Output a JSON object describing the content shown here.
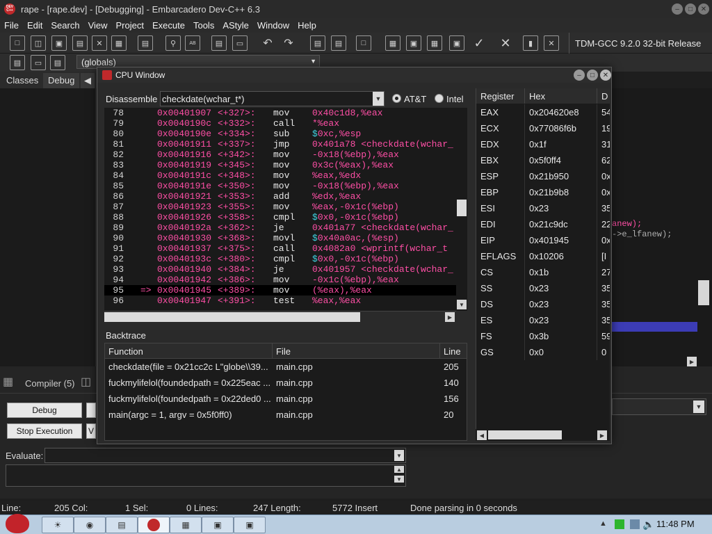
{
  "window": {
    "title": "rape - [rape.dev] - [Debugging] - Embarcadero Dev-C++ 6.3",
    "app_icon_text": "DEV C++"
  },
  "menu": [
    "File",
    "Edit",
    "Search",
    "View",
    "Project",
    "Execute",
    "Tools",
    "AStyle",
    "Window",
    "Help"
  ],
  "toolbar": {
    "compiler": "TDM-GCC 9.2.0 32-bit Release",
    "globals_combo": "(globals)"
  },
  "left_tabs": [
    "Classes",
    "Debug"
  ],
  "cpu_window": {
    "title": "CPU Window",
    "disassemble_label": "Disassemble",
    "function_combo": "checkdate(wchar_t*)",
    "syntax_options": [
      "AT&T",
      "Intel"
    ],
    "selected_syntax": "AT&T",
    "disassembly": [
      {
        "line": "78",
        "marker": "",
        "addr": "0x00401907",
        "offset": "<+327>:",
        "mnemonic": "mov",
        "operands": "0x40c1d8,%eax"
      },
      {
        "line": "79",
        "marker": "",
        "addr": "0x0040190c",
        "offset": "<+332>:",
        "mnemonic": "call",
        "operands": "*%eax"
      },
      {
        "line": "80",
        "marker": "",
        "addr": "0x0040190e",
        "offset": "<+334>:",
        "mnemonic": "sub",
        "operands": "$0xc,%esp"
      },
      {
        "line": "81",
        "marker": "",
        "addr": "0x00401911",
        "offset": "<+337>:",
        "mnemonic": "jmp",
        "operands": "0x401a78 <checkdate(wchar_"
      },
      {
        "line": "82",
        "marker": "",
        "addr": "0x00401916",
        "offset": "<+342>:",
        "mnemonic": "mov",
        "operands": "-0x18(%ebp),%eax"
      },
      {
        "line": "83",
        "marker": "",
        "addr": "0x00401919",
        "offset": "<+345>:",
        "mnemonic": "mov",
        "operands": "0x3c(%eax),%eax"
      },
      {
        "line": "84",
        "marker": "",
        "addr": "0x0040191c",
        "offset": "<+348>:",
        "mnemonic": "mov",
        "operands": "%eax,%edx"
      },
      {
        "line": "85",
        "marker": "",
        "addr": "0x0040191e",
        "offset": "<+350>:",
        "mnemonic": "mov",
        "operands": "-0x18(%ebp),%eax"
      },
      {
        "line": "86",
        "marker": "",
        "addr": "0x00401921",
        "offset": "<+353>:",
        "mnemonic": "add",
        "operands": "%edx,%eax"
      },
      {
        "line": "87",
        "marker": "",
        "addr": "0x00401923",
        "offset": "<+355>:",
        "mnemonic": "mov",
        "operands": "%eax,-0x1c(%ebp)"
      },
      {
        "line": "88",
        "marker": "",
        "addr": "0x00401926",
        "offset": "<+358>:",
        "mnemonic": "cmpl",
        "operands": "$0x0,-0x1c(%ebp)"
      },
      {
        "line": "89",
        "marker": "",
        "addr": "0x0040192a",
        "offset": "<+362>:",
        "mnemonic": "je",
        "operands": "0x401a77 <checkdate(wchar_"
      },
      {
        "line": "90",
        "marker": "",
        "addr": "0x00401930",
        "offset": "<+368>:",
        "mnemonic": "movl",
        "operands": "$0x40a0ac,(%esp)"
      },
      {
        "line": "91",
        "marker": "",
        "addr": "0x00401937",
        "offset": "<+375>:",
        "mnemonic": "call",
        "operands": "0x4082a0 <wprintf(wchar_t"
      },
      {
        "line": "92",
        "marker": "",
        "addr": "0x0040193c",
        "offset": "<+380>:",
        "mnemonic": "cmpl",
        "operands": "$0x0,-0x1c(%ebp)"
      },
      {
        "line": "93",
        "marker": "",
        "addr": "0x00401940",
        "offset": "<+384>:",
        "mnemonic": "je",
        "operands": "0x401957 <checkdate(wchar_"
      },
      {
        "line": "94",
        "marker": "",
        "addr": "0x00401942",
        "offset": "<+386>:",
        "mnemonic": "mov",
        "operands": "-0x1c(%ebp),%eax"
      },
      {
        "line": "95",
        "marker": "=>",
        "addr": "0x00401945",
        "offset": "<+389>:",
        "mnemonic": "mov",
        "operands": "(%eax),%eax"
      },
      {
        "line": "96",
        "marker": "",
        "addr": "0x00401947",
        "offset": "<+391>:",
        "mnemonic": "test",
        "operands": "%eax,%eax"
      }
    ],
    "backtrace_label": "Backtrace",
    "backtrace_columns": [
      "Function",
      "File",
      "Line"
    ],
    "backtrace": [
      {
        "function": "checkdate(file = 0x21cc2c L\"globe\\\\39...",
        "file": "main.cpp",
        "line": "205"
      },
      {
        "function": "fuckmylifelol(foundedpath = 0x225eac ...",
        "file": "main.cpp",
        "line": "140"
      },
      {
        "function": "fuckmylifelol(foundedpath = 0x22ded0 ...",
        "file": "main.cpp",
        "line": "156"
      },
      {
        "function": "main(argc = 1, argv = 0x5f0ff0)",
        "file": "main.cpp",
        "line": "20"
      }
    ],
    "register_columns": [
      "Register",
      "Hex",
      "D"
    ],
    "registers": [
      {
        "name": "EAX",
        "hex": "0x204620e8",
        "dec": "54"
      },
      {
        "name": "ECX",
        "hex": "0x77086f6b",
        "dec": "19"
      },
      {
        "name": "EDX",
        "hex": "0x1f",
        "dec": "31"
      },
      {
        "name": "EBX",
        "hex": "0x5f0ff4",
        "dec": "62"
      },
      {
        "name": "ESP",
        "hex": "0x21b950",
        "dec": "0x"
      },
      {
        "name": "EBP",
        "hex": "0x21b9b8",
        "dec": "0x"
      },
      {
        "name": "ESI",
        "hex": "0x23",
        "dec": "35"
      },
      {
        "name": "EDI",
        "hex": "0x21c9dc",
        "dec": "22"
      },
      {
        "name": "EIP",
        "hex": "0x401945",
        "dec": "0x"
      },
      {
        "name": "EFLAGS",
        "hex": "0x10206",
        "dec": "[I"
      },
      {
        "name": "CS",
        "hex": "0x1b",
        "dec": "27"
      },
      {
        "name": "SS",
        "hex": "0x23",
        "dec": "35"
      },
      {
        "name": "DS",
        "hex": "0x23",
        "dec": "35"
      },
      {
        "name": "ES",
        "hex": "0x23",
        "dec": "35"
      },
      {
        "name": "FS",
        "hex": "0x3b",
        "dec": "59"
      },
      {
        "name": "GS",
        "hex": "0x0",
        "dec": "0"
      }
    ]
  },
  "editor_fragments": [
    "anew);",
    "->e_lfanew);"
  ],
  "bottom": {
    "compiler_tab": "Compiler (5)",
    "debug_button": "Debug",
    "stop_button": "Stop Execution",
    "evaluate_label": "Evaluate:"
  },
  "statusbar": {
    "line": "Line:",
    "line_val": "205 Col:",
    "col_val": "1 Sel:",
    "sel_val": "0 Lines:",
    "lines_val": "247 Length:",
    "length_val": "5772 Insert",
    "message": "Done parsing in 0 seconds"
  },
  "taskbar": {
    "clock": "11:48 PM"
  }
}
